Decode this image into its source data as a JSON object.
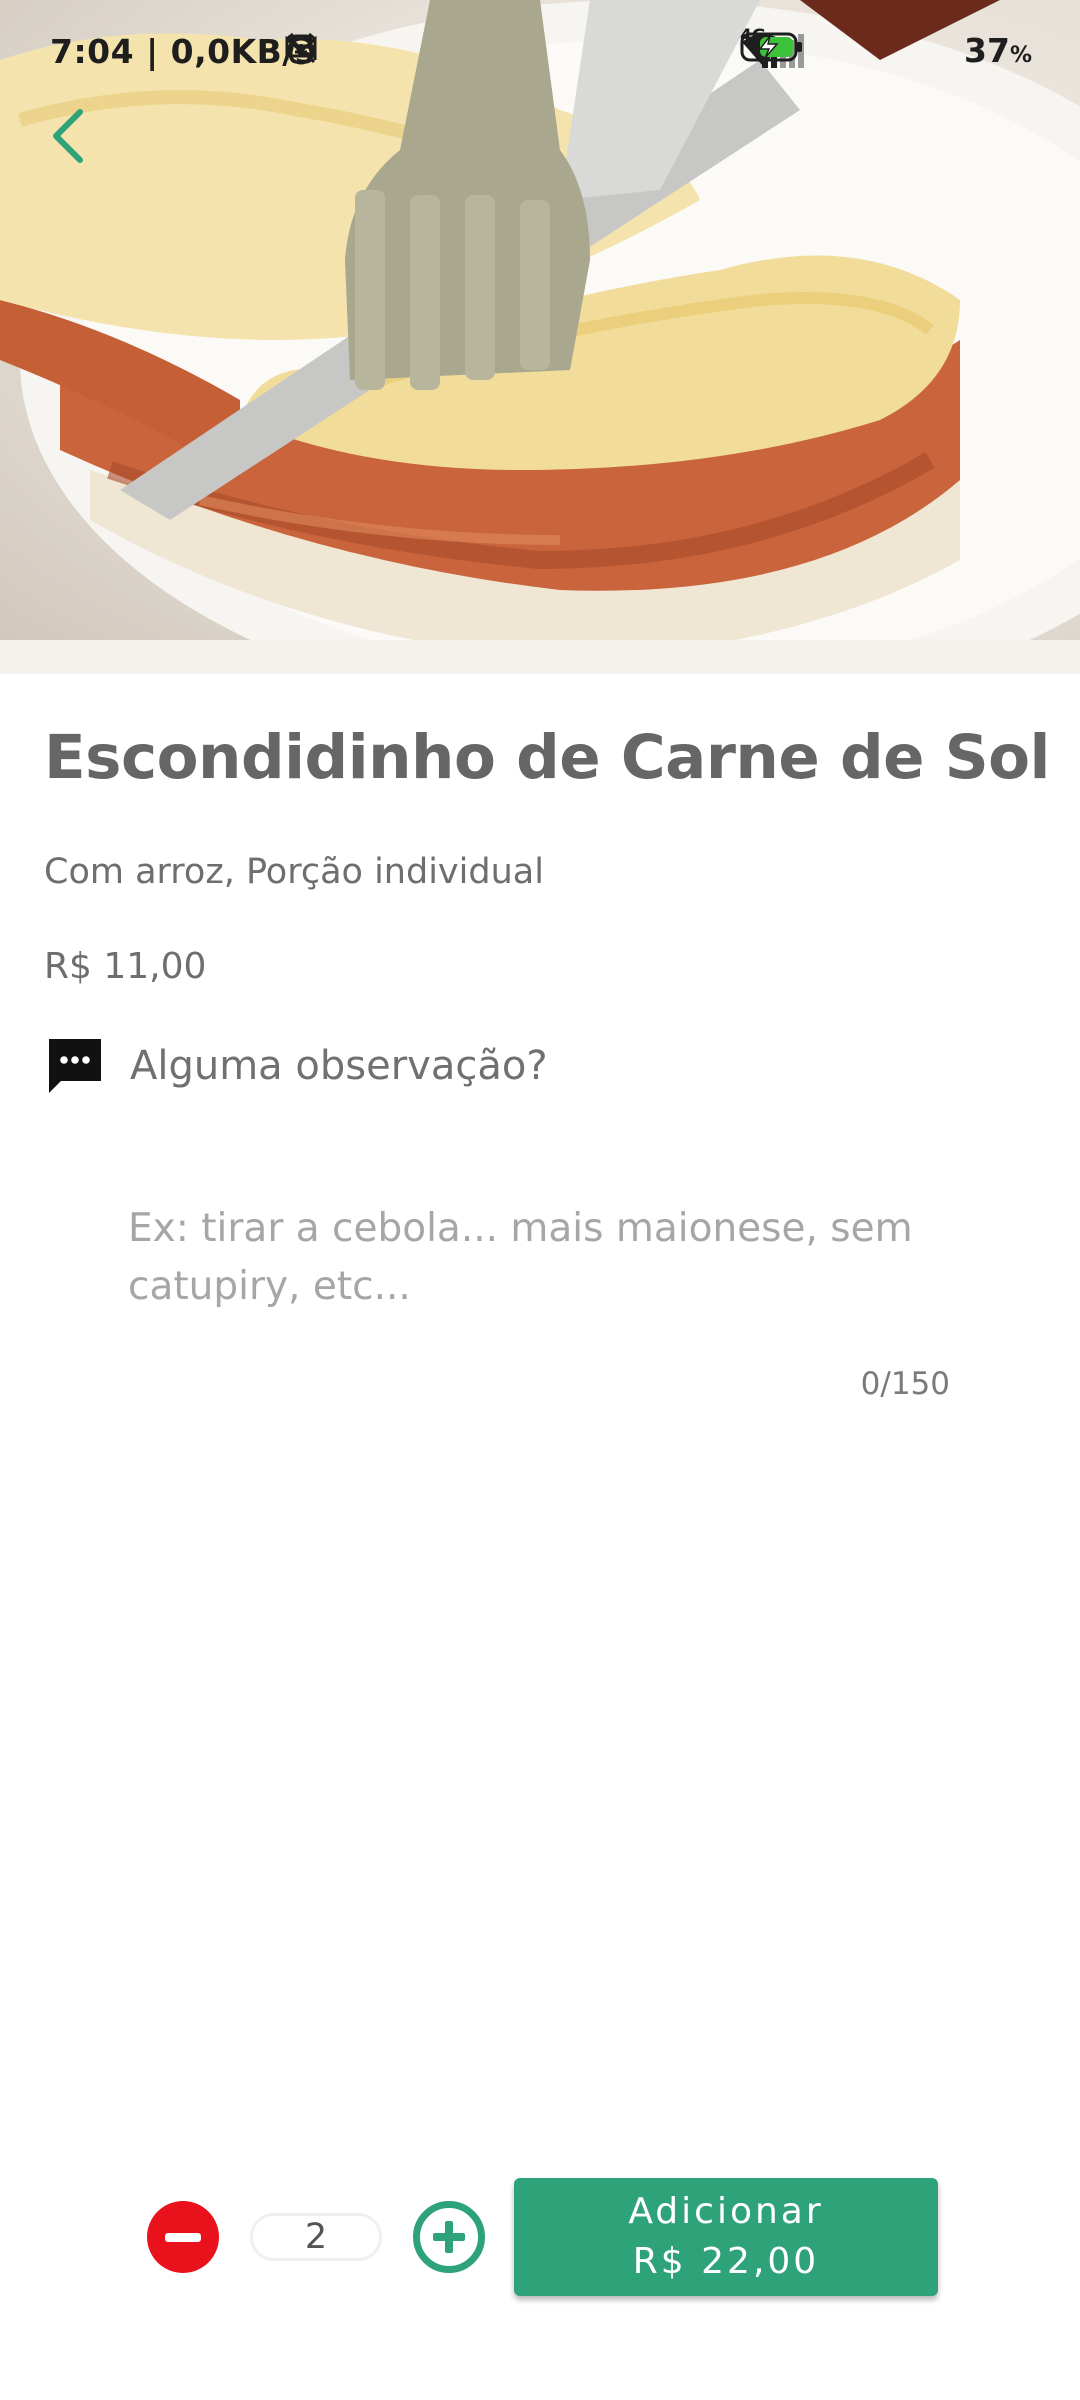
{
  "status_bar": {
    "time": "7:04 | 0,0KB/s",
    "network": "4G",
    "battery_percent": "37",
    "battery_unit": "%",
    "left_icons": [
      "mute-icon",
      "alarm-icon",
      "notification-icon",
      "gmail-icon"
    ],
    "right_icons": [
      "signal-icon",
      "wifi-icon",
      "battery-charging-icon"
    ]
  },
  "hero": {
    "image": "escondidinho-photo"
  },
  "product": {
    "title": "Escondidinho de Carne de Sol",
    "subtitle": "Com arroz, Porção individual",
    "price": "R$ 11,00"
  },
  "observation": {
    "label": "Alguma observação?",
    "placeholder": "Ex: tirar a cebola... mais maionese, sem catupiry, etc...",
    "value": "",
    "counter": "0/150"
  },
  "cart": {
    "quantity": "2",
    "add_label": "Adicionar",
    "add_total": "R$ 22,00"
  },
  "colors": {
    "accent": "#2ea37a",
    "minus": "#e8111c",
    "title": "#666666"
  }
}
